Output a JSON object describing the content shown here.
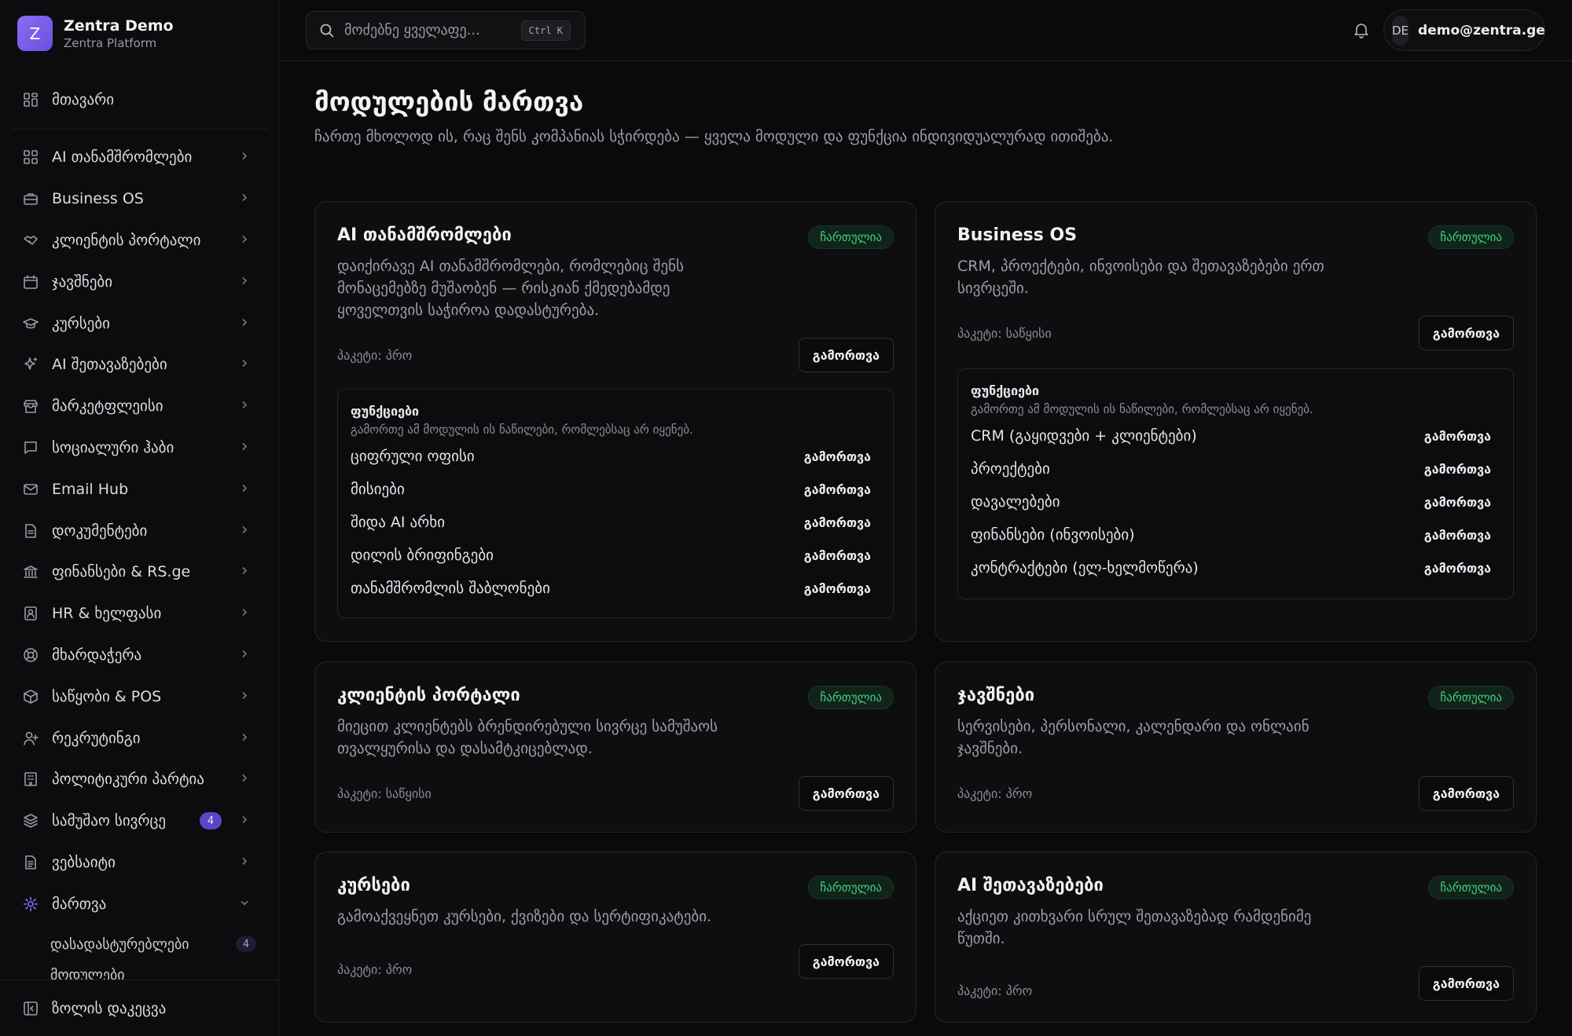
{
  "brand": {
    "logo_letter": "Z",
    "name": "Zentra Demo",
    "subtitle": "Zentra Platform"
  },
  "sidebar": {
    "home_label": "მთავარი",
    "items": [
      {
        "label": "AI თანამშრომლები",
        "icon": "grid-icon"
      },
      {
        "label": "Business OS",
        "icon": "briefcase-icon"
      },
      {
        "label": "კლიენტის პორტალი",
        "icon": "handshake-icon"
      },
      {
        "label": "ჯავშნები",
        "icon": "calendar-icon"
      },
      {
        "label": "კურსები",
        "icon": "graduation-cap-icon"
      },
      {
        "label": "AI შეთავაზებები",
        "icon": "sparkles-icon"
      },
      {
        "label": "მარკეტფლეისი",
        "icon": "store-icon"
      },
      {
        "label": "სოციალური ჰაბი",
        "icon": "chat-icon"
      },
      {
        "label": "Email Hub",
        "icon": "mail-icon"
      },
      {
        "label": "დოკუმენტები",
        "icon": "document-icon"
      },
      {
        "label": "ფინანსები & RS.ge",
        "icon": "bank-icon"
      },
      {
        "label": "HR & ხელფასი",
        "icon": "id-card-icon"
      },
      {
        "label": "მხარდაჭერა",
        "icon": "lifebuoy-icon"
      },
      {
        "label": "საწყობი & POS",
        "icon": "box-icon"
      },
      {
        "label": "რეკრუტინგი",
        "icon": "user-plus-icon"
      },
      {
        "label": "პოლიტიკური პარტია",
        "icon": "building-icon"
      },
      {
        "label": "სამუშაო სივრცე",
        "icon": "layers-icon",
        "badge": "4"
      },
      {
        "label": "ვებსაიტი",
        "icon": "page-icon"
      },
      {
        "label": "მართვა",
        "icon": "gear-icon",
        "active": true
      }
    ],
    "sub_items": [
      {
        "label": "დასადასტურებლები",
        "badge": "4"
      },
      {
        "label": "მოდულები"
      }
    ],
    "collapse_label": "ზოლის დაკეცვა"
  },
  "topbar": {
    "search_placeholder": "მოძებნე ყველაფე...",
    "shortcut": "Ctrl K",
    "user_initials": "DE",
    "user_email": "demo@zentra.ge"
  },
  "page": {
    "title": "მოდულების მართვა",
    "subtitle": "ჩართე მხოლოდ ის, რაც შენს კომპანიას სჭირდება — ყველა მოდული და ფუნქცია ინდივიდუალურად ითიშება."
  },
  "cards": [
    {
      "title": "AI თანამშრომლები",
      "status": "ჩართულია",
      "desc": [
        "დაიქირავე AI თანამშრომლები, რომლებიც შენს",
        "მონაცემებზე მუშაობენ — რისკიან ქმედებამდე",
        "ყოველთვის საჭიროა დადასტურება."
      ],
      "plan": "პაკეტი: პრო",
      "button": "გამორთვა",
      "features": {
        "title": "ფუნქციები",
        "subtitle": "გამორთე ამ მოდულის ის ნაწილები, რომლებსაც არ იყენებ.",
        "items": [
          {
            "label": "ციფრული ოფისი",
            "action": "გამორთვა"
          },
          {
            "label": "მისიები",
            "action": "გამორთვა"
          },
          {
            "label": "შიდა AI არხი",
            "action": "გამორთვა"
          },
          {
            "label": "დილის ბრიფინგები",
            "action": "გამორთვა"
          },
          {
            "label": "თანამშრომლის შაბლონები",
            "action": "გამორთვა"
          }
        ]
      }
    },
    {
      "title": "Business OS",
      "status": "ჩართულია",
      "desc": [
        "CRM, პროექტები, ინვოისები და შეთავაზებები ერთ",
        "სივრცეში."
      ],
      "plan": "პაკეტი: საწყისი",
      "button": "გამორთვა",
      "features": {
        "title": "ფუნქციები",
        "subtitle": "გამორთე ამ მოდულის ის ნაწილები, რომლებსაც არ იყენებ.",
        "items": [
          {
            "label": "CRM (გაყიდვები + კლიენტები)",
            "action": "გამორთვა"
          },
          {
            "label": "პროექტები",
            "action": "გამორთვა"
          },
          {
            "label": "დავალებები",
            "action": "გამორთვა"
          },
          {
            "label": "ფინანსები (ინვოისები)",
            "action": "გამორთვა"
          },
          {
            "label": "კონტრაქტები (ელ-ხელმოწერა)",
            "action": "გამორთვა"
          }
        ]
      }
    },
    {
      "title": "კლიენტის პორტალი",
      "status": "ჩართულია",
      "desc": [
        "მიეცით კლიენტებს ბრენდირებული სივრცე სამუშაოს",
        "თვალყურისა და დასამტკიცებლად."
      ],
      "plan": "პაკეტი: საწყისი",
      "button": "გამორთვა"
    },
    {
      "title": "ჯავშნები",
      "status": "ჩართულია",
      "desc": [
        "სერვისები, პერსონალი, კალენდარი და ონლაინ",
        "ჯავშნები."
      ],
      "plan": "პაკეტი: პრო",
      "button": "გამორთვა"
    },
    {
      "title": "კურსები",
      "status": "ჩართულია",
      "desc": [
        "გამოაქვეყნეთ კურსები, ქვიზები და სერტიფიკატები."
      ],
      "plan": "პაკეტი: პრო",
      "button": "გამორთვა"
    },
    {
      "title": "AI შეთავაზებები",
      "status": "ჩართულია",
      "desc": [
        "აქციეთ კითხვარი სრულ შეთავაზებად რამდენიმე",
        "წუთში."
      ],
      "plan": "პაკეტი: პრო",
      "button": "გამორთვა"
    }
  ]
}
